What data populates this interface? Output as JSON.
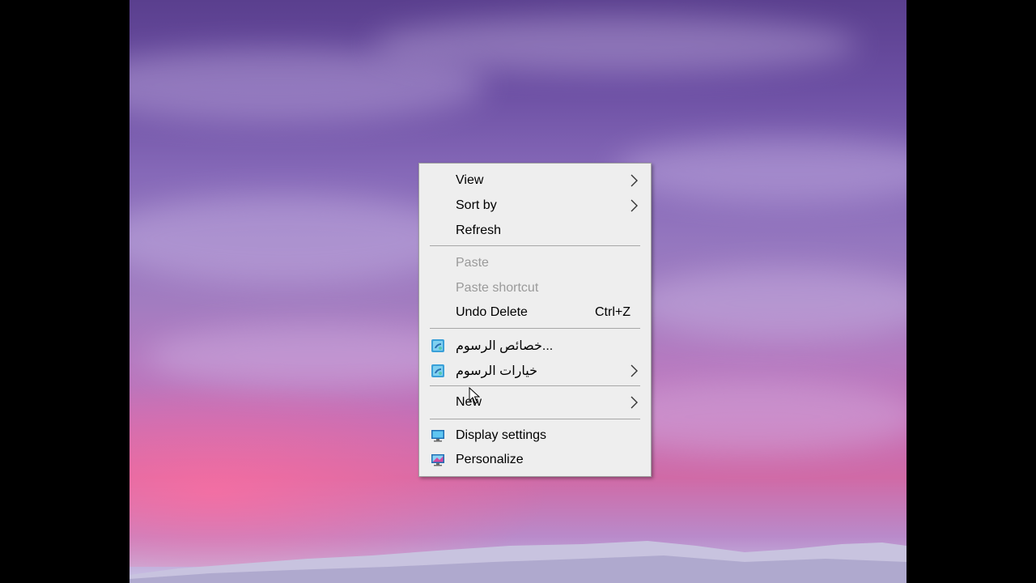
{
  "context_menu": {
    "items": [
      {
        "label": "View",
        "submenu": true,
        "icon": null,
        "enabled": true
      },
      {
        "label": "Sort by",
        "submenu": true,
        "icon": null,
        "enabled": true
      },
      {
        "label": "Refresh",
        "submenu": false,
        "icon": null,
        "enabled": true
      },
      {
        "label": "Paste",
        "submenu": false,
        "icon": null,
        "enabled": false
      },
      {
        "label": "Paste shortcut",
        "submenu": false,
        "icon": null,
        "enabled": false
      },
      {
        "label": "Undo Delete",
        "shortcut": "Ctrl+Z",
        "submenu": false,
        "icon": null,
        "enabled": true
      },
      {
        "label": "خصائص الرسوم...",
        "submenu": false,
        "icon": "graphics-properties-icon",
        "enabled": true
      },
      {
        "label": "خيارات الرسوم",
        "submenu": true,
        "icon": "graphics-options-icon",
        "enabled": true
      },
      {
        "label": "New",
        "submenu": true,
        "icon": null,
        "enabled": true
      },
      {
        "label": "Display settings",
        "submenu": false,
        "icon": "display-settings-icon",
        "enabled": true
      },
      {
        "label": "Personalize",
        "submenu": false,
        "icon": "personalize-icon",
        "enabled": true
      }
    ]
  },
  "colors": {
    "menu_background": "#eeeeee",
    "disabled_text": "#9a9a9a",
    "separator": "#a7a7a7"
  }
}
